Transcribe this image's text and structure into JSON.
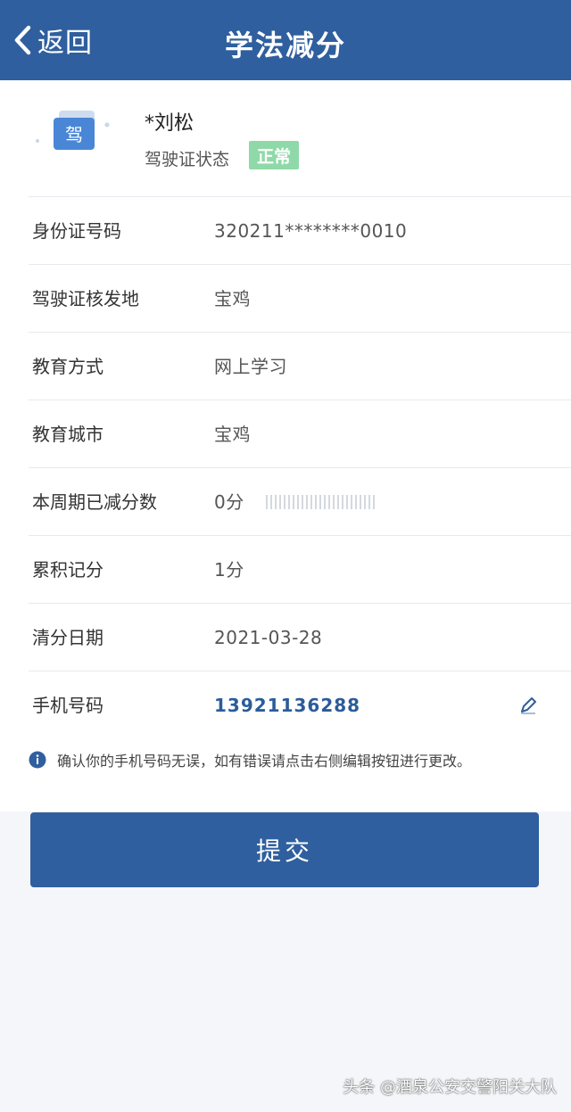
{
  "header": {
    "back_label": "返回",
    "title": "学法减分"
  },
  "profile": {
    "icon_text": "驾",
    "name": "*刘松",
    "status_label": "驾驶证状态",
    "status_value": "正常"
  },
  "rows": [
    {
      "label": "身份证号码",
      "value": "320211********0010"
    },
    {
      "label": "驾驶证核发地",
      "value": "宝鸡"
    },
    {
      "label": "教育方式",
      "value": "网上学习"
    },
    {
      "label": "教育城市",
      "value": "宝鸡"
    },
    {
      "label": "本周期已减分数",
      "value": "0分"
    },
    {
      "label": "累积记分",
      "value": "1分"
    },
    {
      "label": "清分日期",
      "value": "2021-03-28"
    },
    {
      "label": "手机号码",
      "value": "13921136288"
    }
  ],
  "info": {
    "icon": "info-icon",
    "text": "确认你的手机号码无误，如有错误请点击右侧编辑按钮进行更改。"
  },
  "submit_label": "提交",
  "watermark": "头条 @酒泉公安交警阳关大队",
  "colors": {
    "brand": "#2f5f9e",
    "status_badge": "#8fd9a8",
    "phone_text": "#2b5c9a"
  }
}
